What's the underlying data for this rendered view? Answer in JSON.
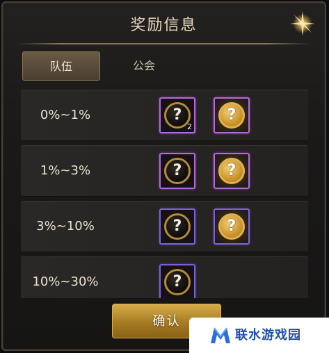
{
  "dialog": {
    "title": "奖励信息",
    "close_icon": "close-star-icon"
  },
  "tabs": [
    {
      "label": "队伍",
      "active": true
    },
    {
      "label": "公会",
      "active": false
    }
  ],
  "rows": [
    {
      "label": "0%~1%",
      "items": [
        {
          "icon": "mystery-box-icon",
          "frame": "purple",
          "qty": "2"
        },
        {
          "icon": "gold-mystery-box-icon",
          "frame": "purple"
        }
      ]
    },
    {
      "label": "1%~3%",
      "items": [
        {
          "icon": "mystery-box-icon",
          "frame": "purple"
        },
        {
          "icon": "gold-mystery-box-icon",
          "frame": "purple"
        }
      ]
    },
    {
      "label": "3%~10%",
      "items": [
        {
          "icon": "mystery-box-icon",
          "frame": "violet"
        },
        {
          "icon": "gold-mystery-box-icon",
          "frame": "violet"
        }
      ]
    },
    {
      "label": "10%~30%",
      "items": [
        {
          "icon": "mystery-box-icon",
          "frame": "violet"
        }
      ]
    }
  ],
  "item_symbol": "?",
  "confirm_label": "确认",
  "watermark": {
    "text": "联水游戏园",
    "logo": "m-logo-icon"
  },
  "colors": {
    "gold_accent": "#d7ad4a",
    "purple_frame": "#b46ad9",
    "violet_frame": "#7e62d4"
  }
}
